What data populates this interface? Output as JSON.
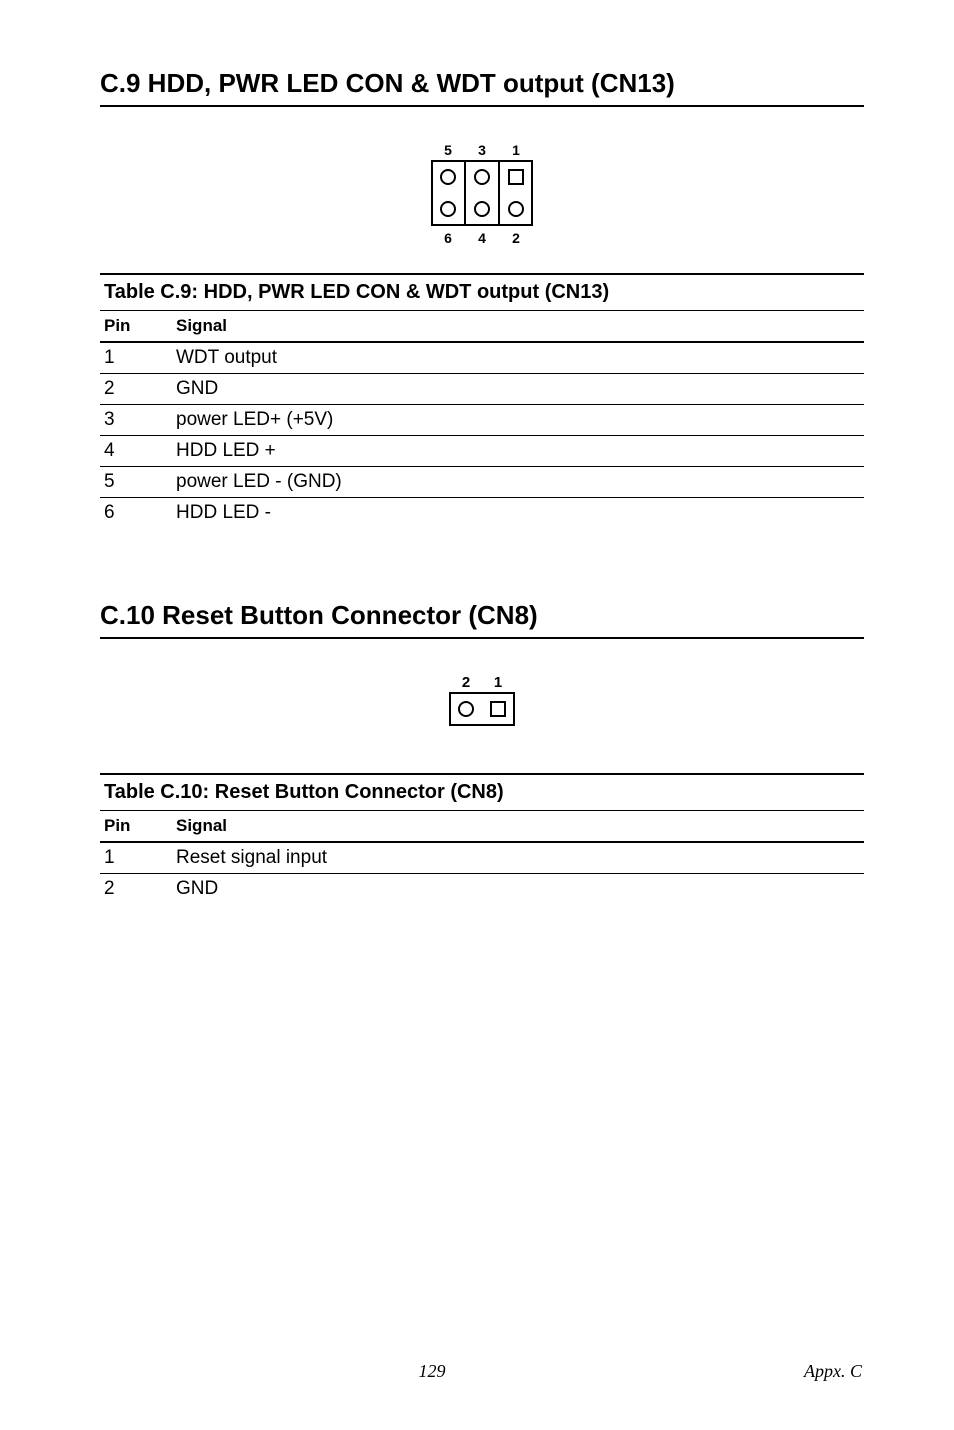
{
  "section1": {
    "title": "C.9 HDD, PWR LED CON & WDT output (CN13)",
    "diagram": {
      "top_labels": [
        "5",
        "3",
        "1"
      ],
      "bottom_labels": [
        "6",
        "4",
        "2"
      ]
    },
    "table": {
      "caption": "Table C.9: HDD, PWR LED CON & WDT output (CN13)",
      "head_pin": "Pin",
      "head_sig": "Signal",
      "rows": [
        {
          "pin": "1",
          "sig": "WDT output"
        },
        {
          "pin": "2",
          "sig": "GND"
        },
        {
          "pin": "3",
          "sig": "power LED+ (+5V)"
        },
        {
          "pin": "4",
          "sig": "HDD LED +"
        },
        {
          "pin": "5",
          "sig": "power LED - (GND)"
        },
        {
          "pin": "6",
          "sig": "HDD LED -"
        }
      ]
    }
  },
  "section2": {
    "title": "C.10 Reset Button Connector (CN8)",
    "diagram": {
      "top_labels": [
        "2",
        "1"
      ]
    },
    "table": {
      "caption": "Table C.10: Reset Button Connector (CN8)",
      "head_pin": "Pin",
      "head_sig": "Signal",
      "rows": [
        {
          "pin": "1",
          "sig": "Reset signal input"
        },
        {
          "pin": "2",
          "sig": "GND"
        }
      ]
    }
  },
  "footer": {
    "page": "129",
    "appx": "Appx. C"
  }
}
